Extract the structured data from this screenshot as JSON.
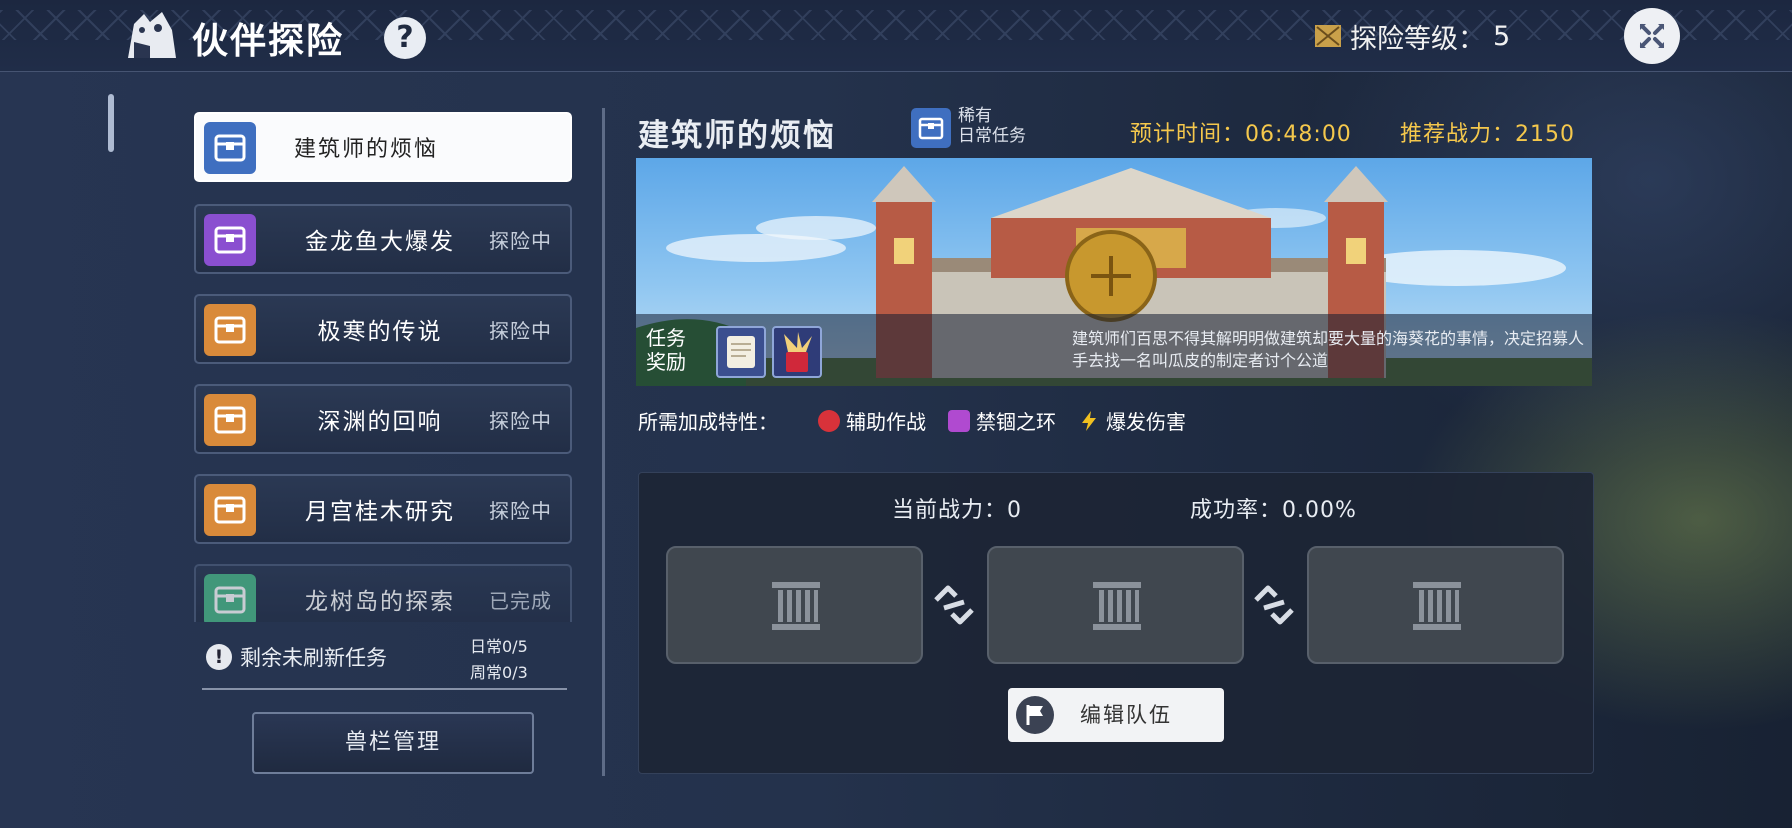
{
  "header": {
    "title": "伙伴探险",
    "help_label": "?",
    "level_label": "探险等级：",
    "level_value": "5"
  },
  "quests": [
    {
      "name": "建筑师的烦恼",
      "status": "",
      "chest_color": "#3f6fc0",
      "selected": true
    },
    {
      "name": "金龙鱼大爆发",
      "status": "探险中",
      "chest_color": "#8a4fd0"
    },
    {
      "name": "极寒的传说",
      "status": "探险中",
      "chest_color": "#d98a3a"
    },
    {
      "name": "深渊的回响",
      "status": "探险中",
      "chest_color": "#d98a3a"
    },
    {
      "name": "月宫桂木研究",
      "status": "探险中",
      "chest_color": "#d98a3a"
    },
    {
      "name": "龙树岛的探索",
      "status": "已完成",
      "chest_color": "#4bb889"
    }
  ],
  "refresh": {
    "label": "剩余未刷新任务",
    "daily": "日常0/5",
    "weekly": "周常0/3"
  },
  "manage_button": "兽栏管理",
  "detail": {
    "title": "建筑师的烦恼",
    "rarity": "稀有",
    "type": "日常任务",
    "time_label": "预计时间：06:48:00",
    "power_label": "推荐战力：2150",
    "reward_label_1": "任务",
    "reward_label_2": "奖励",
    "description": "建筑师们百思不得其解明明做建筑却要大量的海葵花的事情，决定招募人手去找一名叫瓜皮的制定者讨个公道",
    "traits_label": "所需加成特性：",
    "traits": [
      {
        "name": "辅助作战",
        "color": "#d8323a"
      },
      {
        "name": "禁锢之环",
        "color": "#b04ad0"
      },
      {
        "name": "爆发伤害",
        "color": "#f0c020"
      }
    ]
  },
  "team": {
    "current_power": "当前战力：0",
    "success_rate": "成功率：0.00%",
    "edit_button": "编辑队伍"
  },
  "colors": {
    "accent_gold": "#f5c84c",
    "panel_bg": "#1c2434"
  }
}
